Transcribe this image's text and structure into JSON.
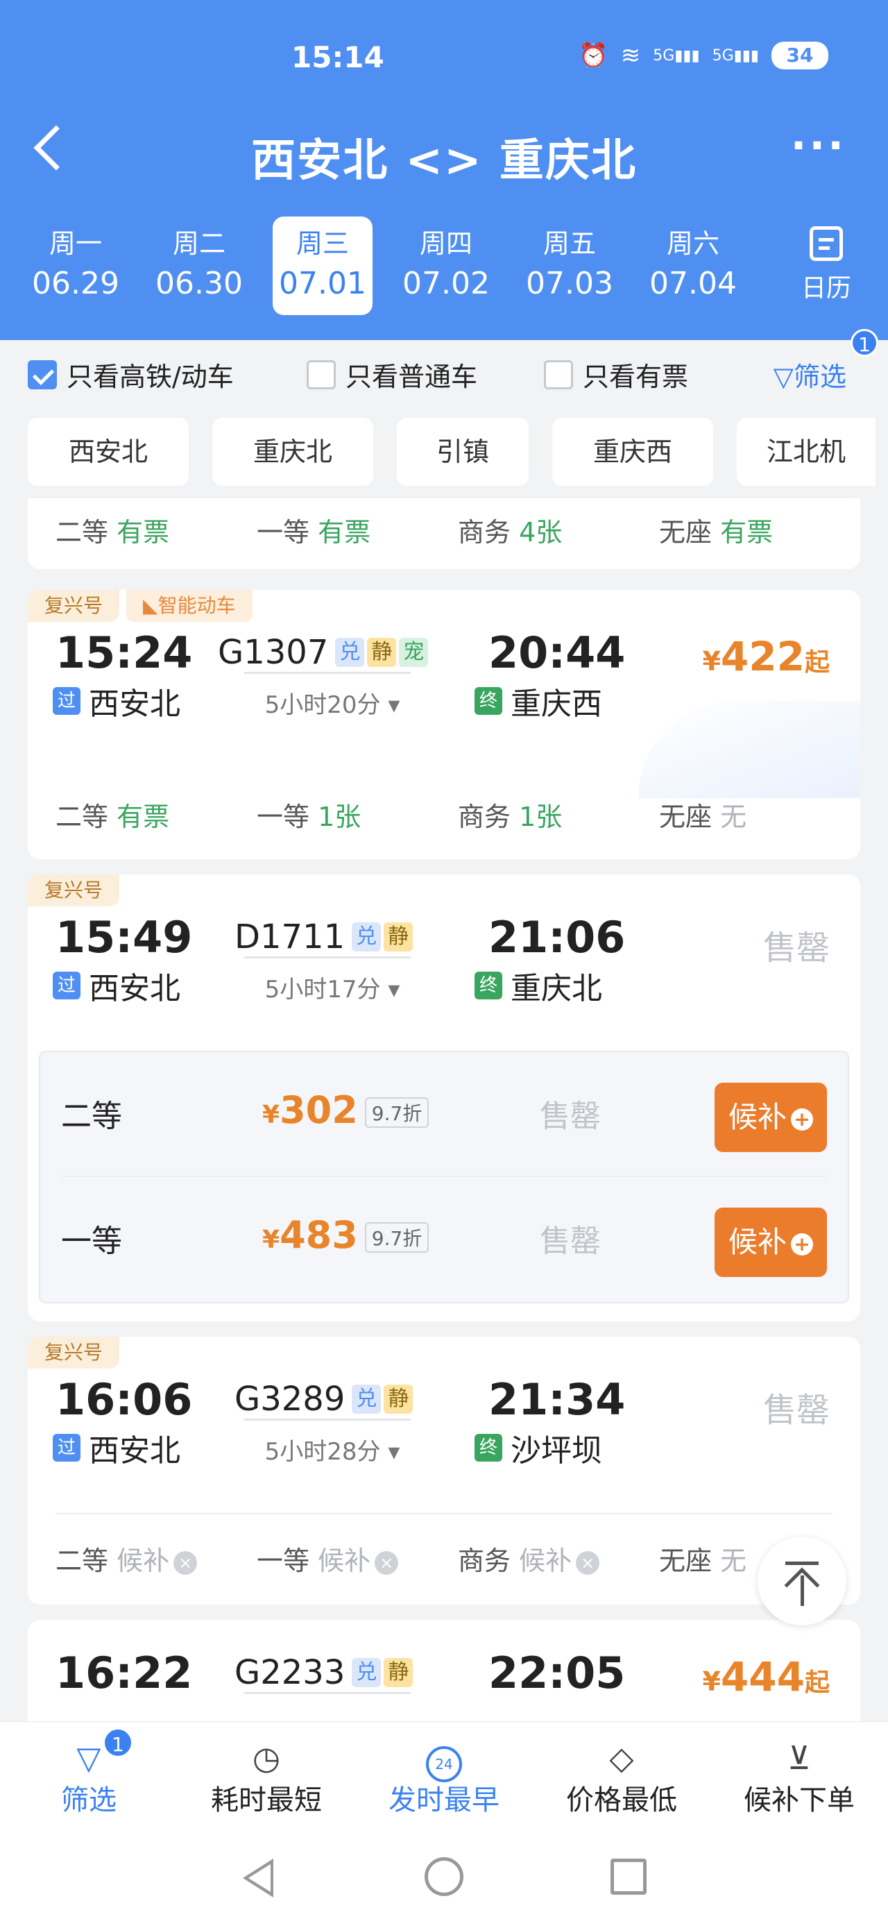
{
  "status_bar": {
    "time": "15:14",
    "battery": "34",
    "network": "5G",
    "network2": "5G"
  },
  "header": {
    "title": "西安北 <> 重庆北",
    "more": "···",
    "dates": [
      {
        "weekday": "周一",
        "date": "06.29"
      },
      {
        "weekday": "周二",
        "date": "06.30"
      },
      {
        "weekday": "周三",
        "date": "07.01"
      },
      {
        "weekday": "周四",
        "date": "07.02"
      },
      {
        "weekday": "周五",
        "date": "07.03"
      },
      {
        "weekday": "周六",
        "date": "07.04"
      }
    ],
    "active_date_index": 2,
    "calendar_label": "日历"
  },
  "filters": {
    "only_high_speed": {
      "label": "只看高铁/动车",
      "checked": true
    },
    "only_normal": {
      "label": "只看普通车",
      "checked": false
    },
    "only_available": {
      "label": "只看有票",
      "checked": false
    },
    "filter_button": "筛选",
    "filter_count": "1"
  },
  "stations": [
    "西安北",
    "重庆北",
    "引镇",
    "重庆西",
    "江北机"
  ],
  "partial_card": {
    "seats": [
      {
        "class": "二等",
        "status": "有票"
      },
      {
        "class": "一等",
        "status": "有票"
      },
      {
        "class": "商务",
        "status": "4张"
      },
      {
        "class": "无座",
        "status": "有票"
      }
    ]
  },
  "trains": [
    {
      "tags": [
        "复兴号",
        "智能动车"
      ],
      "depart": "15:24",
      "number": "G1307",
      "badges": [
        "兑",
        "静",
        "宠"
      ],
      "arrive": "20:44",
      "duration": "5小时20分",
      "from_mark": "过",
      "from": "西安北",
      "to_mark": "终",
      "to": "重庆西",
      "price_symbol": "¥",
      "price": "422",
      "price_suffix": "起",
      "seats": [
        {
          "class": "二等",
          "status": "有票"
        },
        {
          "class": "一等",
          "status": "1张"
        },
        {
          "class": "商务",
          "status": "1张"
        },
        {
          "class": "无座",
          "status": "无"
        }
      ]
    },
    {
      "tags": [
        "复兴号"
      ],
      "depart": "15:49",
      "number": "D1711",
      "badges": [
        "兑",
        "静"
      ],
      "arrive": "21:06",
      "duration": "5小时17分",
      "from_mark": "过",
      "from": "西安北",
      "to_mark": "终",
      "to": "重庆北",
      "status": "售罄",
      "seat_options": [
        {
          "class": "二等",
          "price_symbol": "¥",
          "price": "302",
          "discount": "9.7折",
          "status": "售罄",
          "action": "候补"
        },
        {
          "class": "一等",
          "price_symbol": "¥",
          "price": "483",
          "discount": "9.7折",
          "status": "售罄",
          "action": "候补"
        }
      ]
    },
    {
      "tags": [
        "复兴号"
      ],
      "depart": "16:06",
      "number": "G3289",
      "badges": [
        "兑",
        "静"
      ],
      "arrive": "21:34",
      "duration": "5小时28分",
      "from_mark": "过",
      "from": "西安北",
      "to_mark": "终",
      "to": "沙坪坝",
      "status": "售罄",
      "seats": [
        {
          "class": "二等",
          "status": "候补"
        },
        {
          "class": "一等",
          "status": "候补"
        },
        {
          "class": "商务",
          "status": "候补"
        },
        {
          "class": "无座",
          "status": "无"
        }
      ]
    },
    {
      "depart": "16:22",
      "number": "G2233",
      "badges": [
        "兑",
        "静"
      ],
      "arrive": "22:05",
      "price_symbol": "¥",
      "price": "444",
      "price_suffix": "起"
    }
  ],
  "bottom_bar": {
    "items": [
      {
        "label": "筛选",
        "icon": "filter-icon",
        "badge": "1"
      },
      {
        "label": "耗时最短",
        "icon": "timer-icon"
      },
      {
        "label": "发时最早",
        "icon": "clock-24-icon"
      },
      {
        "label": "价格最低",
        "icon": "price-tag-icon"
      },
      {
        "label": "候补下单",
        "icon": "cart-icon"
      }
    ],
    "clock_text": "24"
  },
  "colors": {
    "primary": "#4f8ff2",
    "accent_price": "#e8852a",
    "available": "#3aa55f",
    "waitlist_button": "#ea7c2c"
  }
}
